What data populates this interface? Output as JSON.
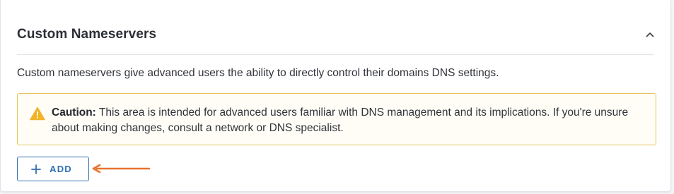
{
  "section": {
    "title": "Custom Nameservers",
    "toggle_icon": "chevron-up-icon",
    "description": "Custom nameservers give advanced users the ability to directly control their domains DNS settings."
  },
  "caution": {
    "icon": "warning-triangle-icon",
    "label": "Caution:",
    "text": " This area is intended for advanced users familiar with DNS management and its implications. If you're unsure about making changes, consult a network or DNS specialist."
  },
  "actions": {
    "add_label": "ADD",
    "add_icon": "plus-icon"
  },
  "annotation": {
    "icon": "arrow-left-icon"
  },
  "colors": {
    "accent": "#2f6fb2",
    "warning_border": "#e6c45c",
    "warning_icon": "#f0b429",
    "annotation_arrow": "#e8732e"
  }
}
